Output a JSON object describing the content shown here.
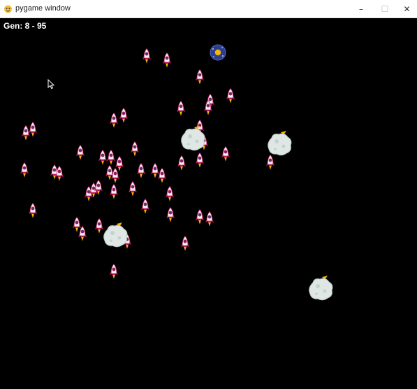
{
  "window": {
    "title": "pygame window",
    "controls": {
      "minimize": "–",
      "maximize": "☐",
      "close": "✕"
    }
  },
  "hud": {
    "generation_label": "Gen: 8 - 95"
  },
  "colors": {
    "background": "#000000",
    "rocket_body": "#f4f0f6",
    "rocket_accent": "#c2185b",
    "rocket_window": "#4a3a66",
    "flame": "#ffb300",
    "asteroid": "#dfe7e5",
    "planet": "#2c3e8f",
    "planet_core": "#f5b700"
  }
}
